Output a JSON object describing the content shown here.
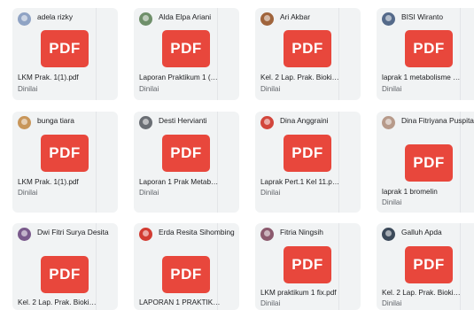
{
  "status_label": "Dinilai",
  "pdf_label": "PDF",
  "colors": {
    "pdf_red": "#e8473c",
    "card_bg": "#f1f3f4",
    "status_gray": "#5f6368"
  },
  "submissions": [
    {
      "student": "adela rizky",
      "file": "LKM Prak. 1(1).pdf",
      "avatar_color": "#8fa3c4",
      "icon": "avatar-icon"
    },
    {
      "student": "Alda Elpa Ariani",
      "file": "Laporan Praktikum 1 (…",
      "avatar_color": "#6f8f6a",
      "icon": "avatar-icon"
    },
    {
      "student": "Ari Akbar",
      "file": "Kel. 2 Lap. Prak. Bioki…",
      "avatar_color": "#a0643c",
      "icon": "avatar-icon"
    },
    {
      "student": "BISI Wiranto",
      "file": "laprak 1 metabolisme …",
      "avatar_color": "#556a8a",
      "icon": "avatar-icon"
    },
    {
      "student": "bunga tiara",
      "file": "LKM Prak. 1(1).pdf",
      "avatar_color": "#c8965a",
      "icon": "avatar-icon"
    },
    {
      "student": "Desti Hervianti",
      "file": "Laporan 1 Prak Metab…",
      "avatar_color": "#6a6e74",
      "icon": "avatar-icon"
    },
    {
      "student": "Dina Anggraini",
      "file": "Laprak Pert.1 Kel 11.p…",
      "avatar_color": "#d2463c",
      "icon": "avatar-icon"
    },
    {
      "student": "Dina Fitriyana Puspita",
      "file": "laprak 1 bromelin",
      "avatar_color": "#b79a8a",
      "icon": "avatar-icon"
    },
    {
      "student": "Dwi Fitri Surya Desita",
      "file": "Kel. 2 Lap. Prak. Bioki…",
      "avatar_color": "#7a5a8c",
      "icon": "avatar-icon"
    },
    {
      "student": "Erda Resita Sihombing",
      "file": "LAPORAN 1 PRAKTIK…",
      "avatar_color": "#d23c32",
      "icon": "avatar-icon"
    },
    {
      "student": "Fitria Ningsih",
      "file": "LKM praktikum 1 fix.pdf",
      "avatar_color": "#8c5a6e",
      "icon": "avatar-icon"
    },
    {
      "student": "Galluh Apda",
      "file": "Kel. 2 Lap. Prak. Bioki…",
      "avatar_color": "#3c4a5a",
      "icon": "avatar-icon"
    }
  ]
}
